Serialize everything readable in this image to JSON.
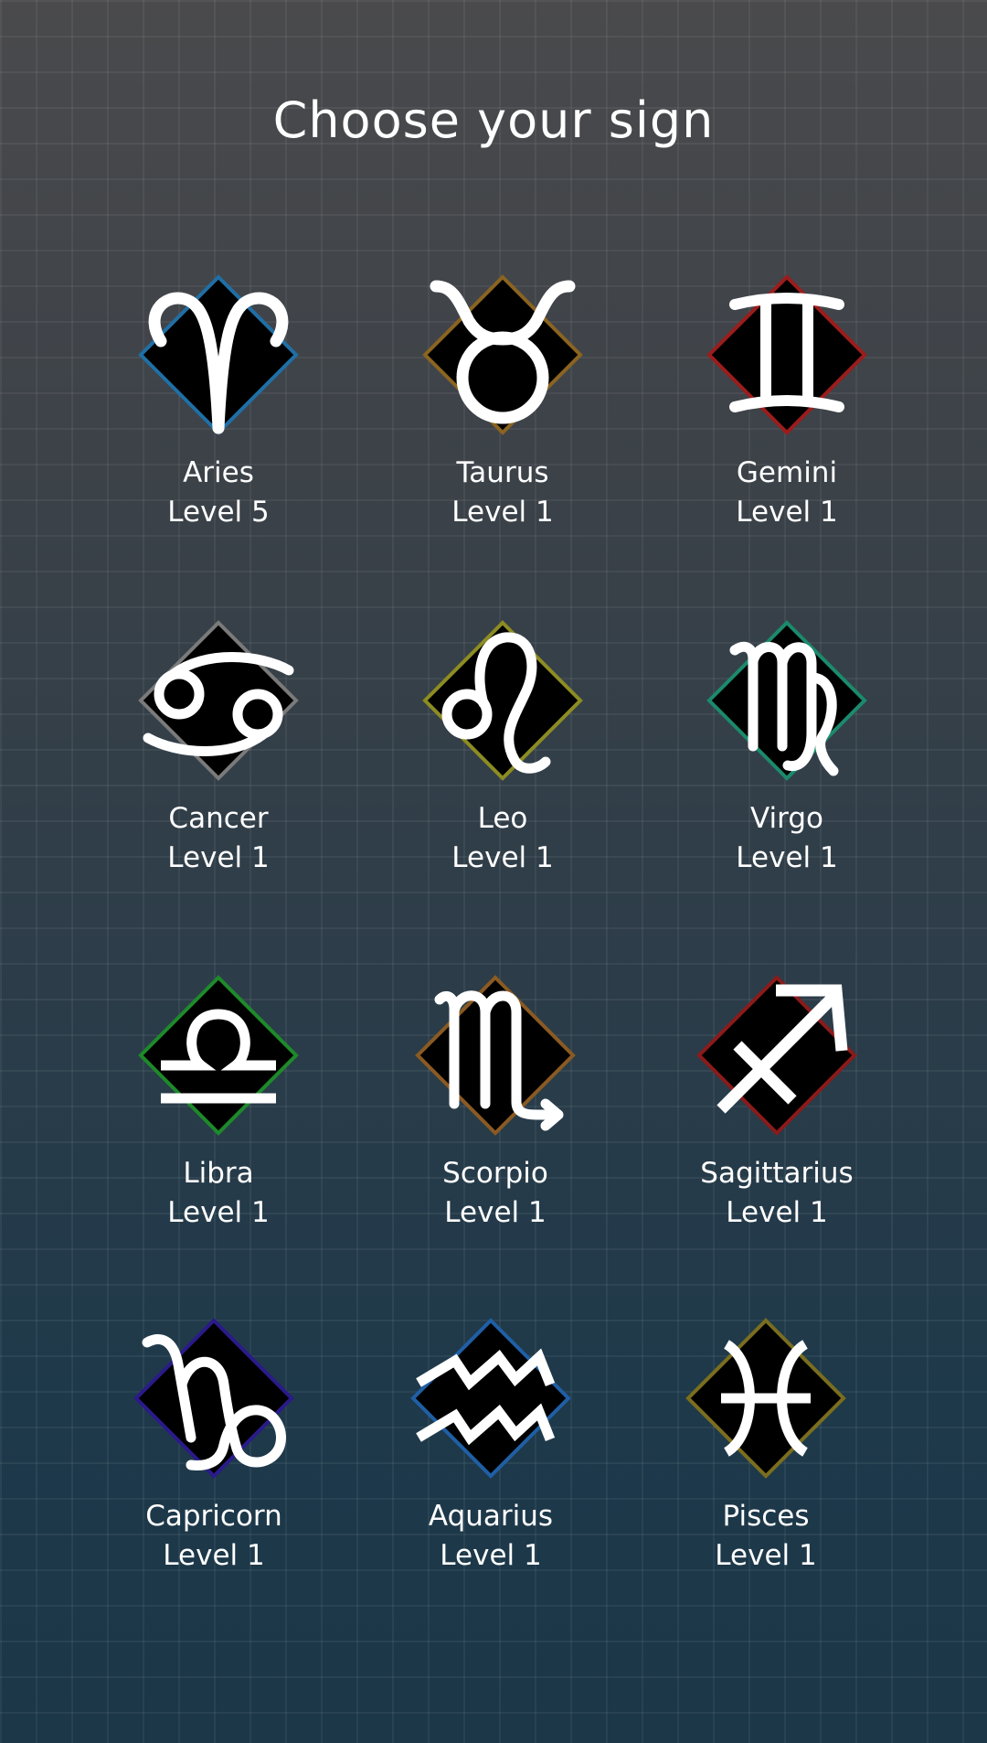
{
  "title": "Choose your sign",
  "signs": [
    {
      "name": "Aries",
      "level": "Level 5",
      "color": "#1f6fa6",
      "icon": "aries-icon"
    },
    {
      "name": "Taurus",
      "level": "Level 1",
      "color": "#8a6420",
      "icon": "taurus-icon"
    },
    {
      "name": "Gemini",
      "level": "Level 1",
      "color": "#9c1c1c",
      "icon": "gemini-icon"
    },
    {
      "name": "Cancer",
      "level": "Level 1",
      "color": "#7a7a7a",
      "icon": "cancer-icon"
    },
    {
      "name": "Leo",
      "level": "Level 1",
      "color": "#8c8c22",
      "icon": "leo-icon"
    },
    {
      "name": "Virgo",
      "level": "Level 1",
      "color": "#1b8a6c",
      "icon": "virgo-icon"
    },
    {
      "name": "Libra",
      "level": "Level 1",
      "color": "#1d8a2a",
      "icon": "libra-icon"
    },
    {
      "name": "Scorpio",
      "level": "Level 1",
      "color": "#8a5a22",
      "icon": "scorpio-icon"
    },
    {
      "name": "Sagittarius",
      "level": "Level 1",
      "color": "#8c1a1a",
      "icon": "sagittarius-icon"
    },
    {
      "name": "Capricorn",
      "level": "Level 1",
      "color": "#2a1a8a",
      "icon": "capricorn-icon"
    },
    {
      "name": "Aquarius",
      "level": "Level 1",
      "color": "#1f5fa6",
      "icon": "aquarius-icon"
    },
    {
      "name": "Pisces",
      "level": "Level 1",
      "color": "#7a6e1e",
      "icon": "pisces-icon"
    }
  ]
}
